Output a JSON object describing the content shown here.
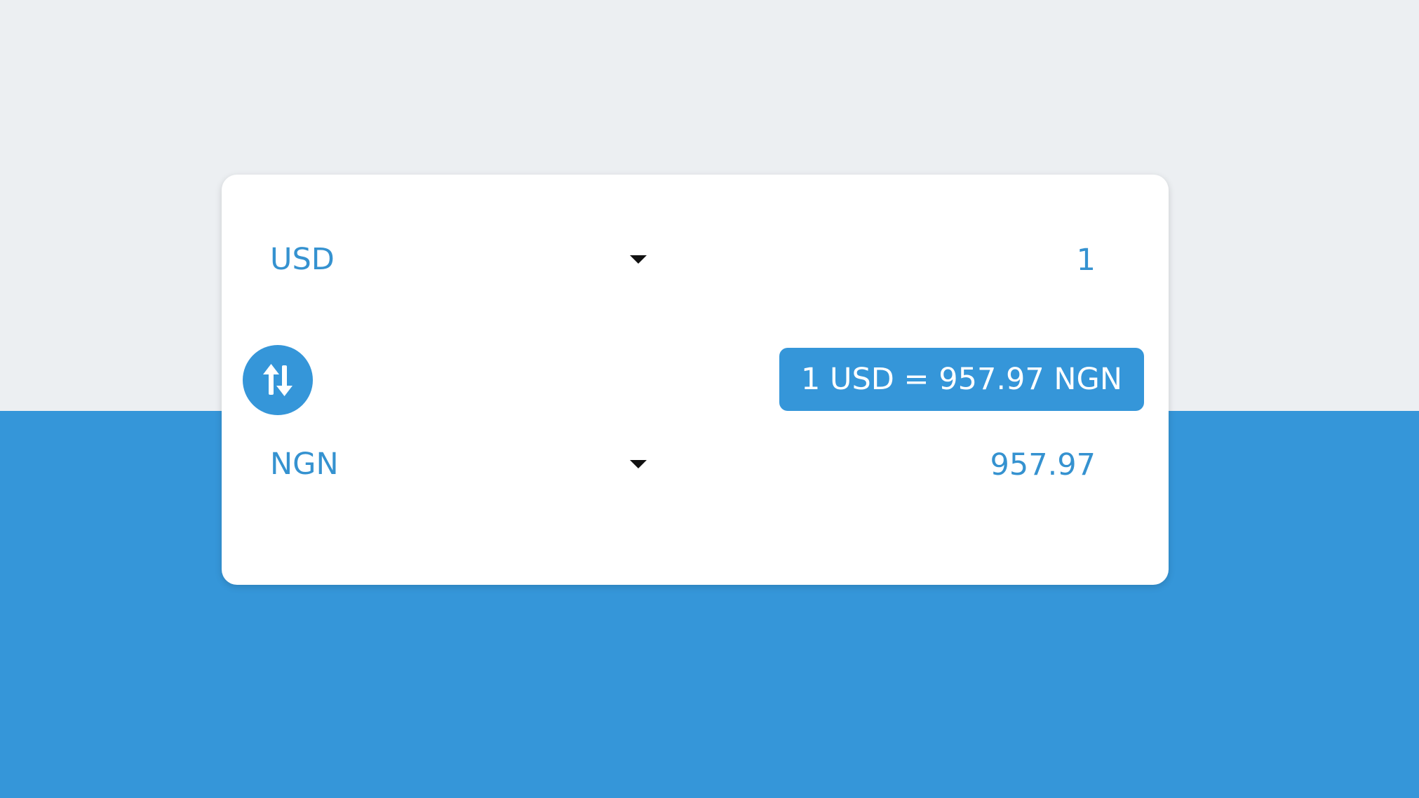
{
  "converter": {
    "from": {
      "currency": "USD",
      "amount": "1"
    },
    "to": {
      "currency": "NGN",
      "amount": "957.97"
    },
    "rate_text": "1 USD = 957.97 NGN",
    "swap_icon": "swap-vertical-arrows-icon",
    "dropdown_icon": "caret-down-icon"
  },
  "colors": {
    "accent": "#3596d9",
    "text_accent": "#3592d0",
    "background_top": "#eceff2",
    "card": "#ffffff"
  }
}
